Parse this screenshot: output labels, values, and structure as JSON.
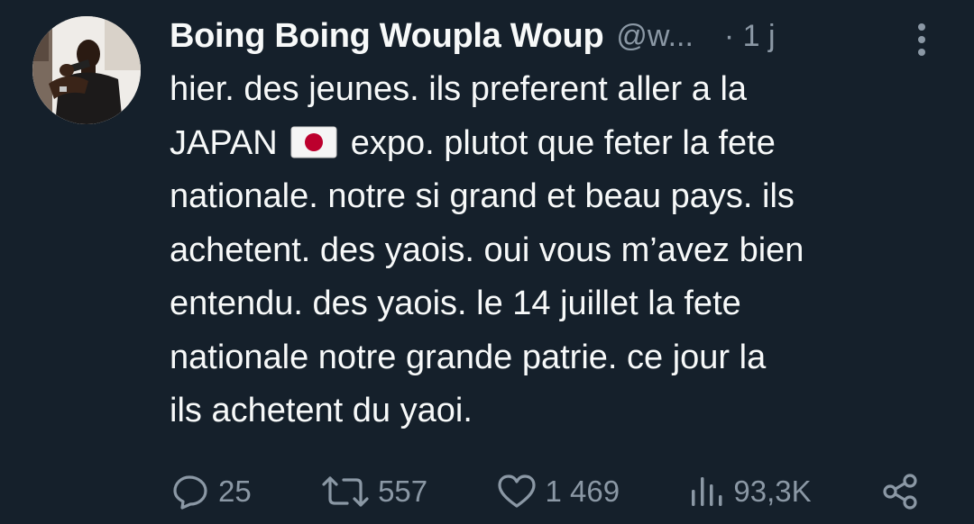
{
  "tweet": {
    "display_name": "Boing Boing Woupla Woup",
    "handle": "@w...",
    "time": "· 1 j",
    "text_before_flag": "hier. des jeunes. ils preferent aller a la\nJAPAN ",
    "text_after_flag": " expo. plutot que feter la fete\nnationale. notre si grand et beau pays. ils\nachetent. des yaois. oui vous m’avez bien\nentendu. des yaois. le 14 juillet la fete\nnationale notre grande patrie. ce jour la\nils achetent du yaoi."
  },
  "actions": {
    "replies": "25",
    "reposts": "557",
    "likes": "1 469",
    "views": "93,3K"
  },
  "icons": {
    "reply": "reply-icon",
    "repost": "repost-icon",
    "like": "heart-icon",
    "views": "views-icon",
    "share": "share-icon",
    "more": "more-icon",
    "flag": "japan-flag-emoji"
  },
  "colors": {
    "background": "#15202b",
    "text": "#f7f9f9",
    "muted": "#8b98a5",
    "flag_red": "#bc002d"
  }
}
